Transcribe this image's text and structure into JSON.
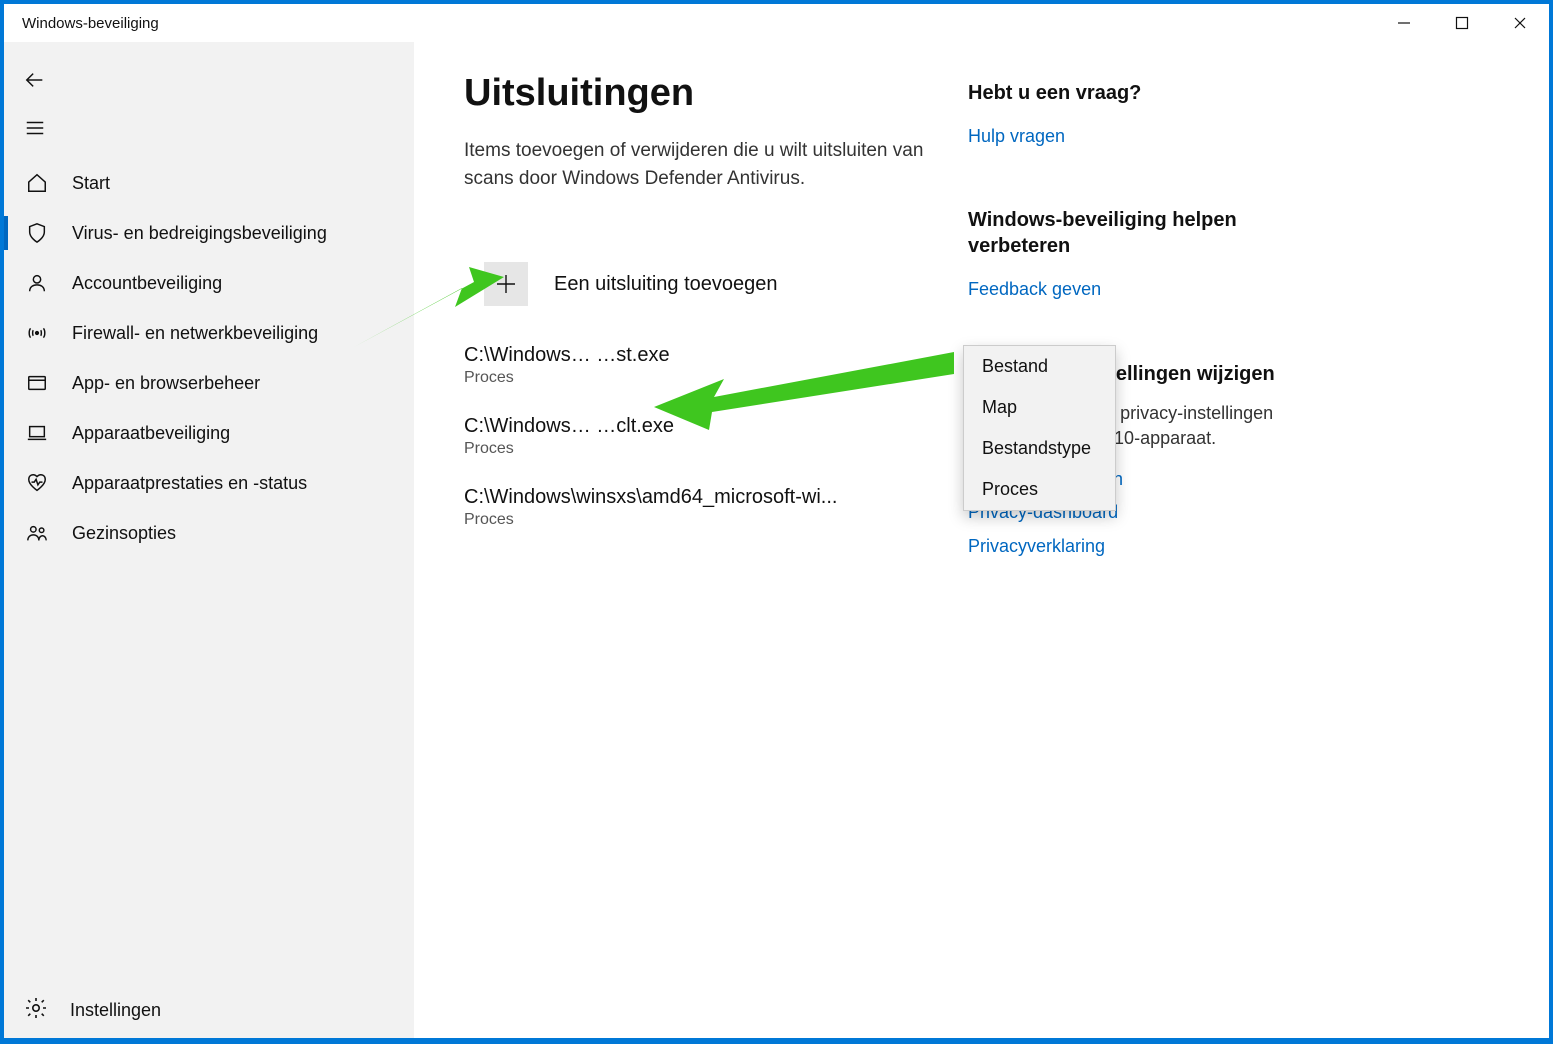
{
  "window": {
    "title": "Windows-beveiliging"
  },
  "sidebar": {
    "items": [
      {
        "label": "Start"
      },
      {
        "label": "Virus- en bedreigingsbeveiliging"
      },
      {
        "label": "Accountbeveiliging"
      },
      {
        "label": "Firewall- en netwerkbeveiliging"
      },
      {
        "label": "App- en browserbeheer"
      },
      {
        "label": "Apparaatbeveiliging"
      },
      {
        "label": "Apparaatprestaties en -status"
      },
      {
        "label": "Gezinsopties"
      }
    ],
    "settings_label": "Instellingen",
    "active_index": 1
  },
  "main": {
    "title": "Uitsluitingen",
    "description": "Items toevoegen of verwijderen die u wilt uitsluiten van scans door Windows Defender Antivirus.",
    "add_label": "Een uitsluiting toevoegen",
    "exclusions": [
      {
        "path": "C:\\Windows…           …st.exe",
        "type": "Proces"
      },
      {
        "path": "C:\\Windows…           …clt.exe",
        "type": "Proces"
      },
      {
        "path": "C:\\Windows\\winsxs\\amd64_microsoft-wi...",
        "type": "Proces"
      }
    ]
  },
  "dropdown": {
    "items": [
      "Bestand",
      "Map",
      "Bestandstype",
      "Proces"
    ]
  },
  "right": {
    "help": {
      "heading": "Hebt u een vraag?",
      "link": "Hulp vragen"
    },
    "improve": {
      "heading": "Windows-beveiliging helpen verbeteren",
      "link": "Feedback geven"
    },
    "privacy": {
      "heading": "Uw privacy-instellingen wijzigen",
      "text": "Bekijk en wijzig de privacy-instellingen voor uw Windows 10-apparaat.",
      "links": [
        "Privacy-instellingen",
        "Privacy-dashboard",
        "Privacyverklaring"
      ]
    }
  },
  "colors": {
    "accent": "#0067c0",
    "arrow": "#3fc61f"
  }
}
